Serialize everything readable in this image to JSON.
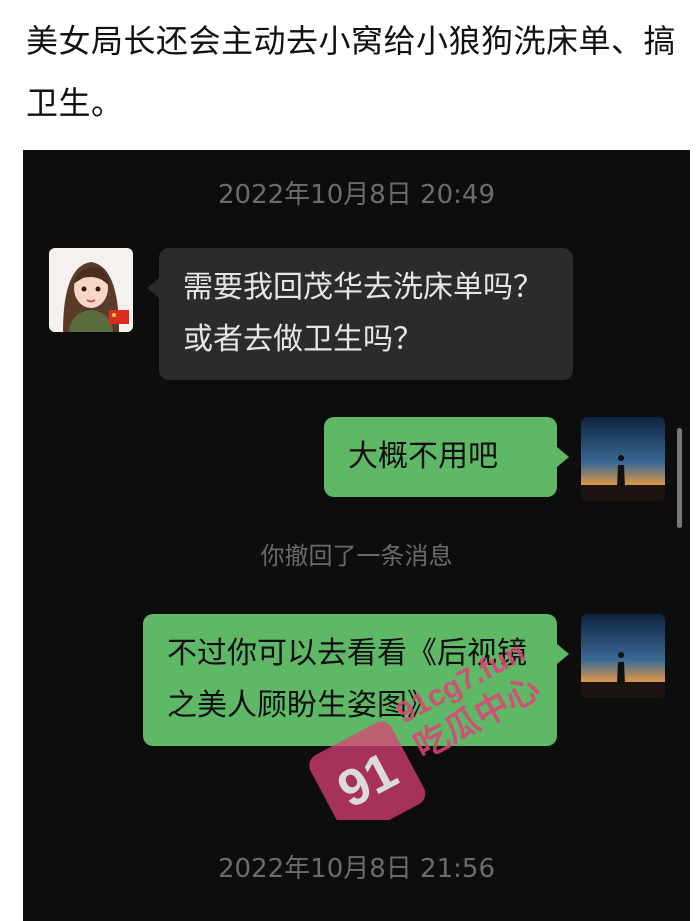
{
  "caption": "美女局长还会主动去小窝给小狼狗洗床单、搞卫生。",
  "chat": {
    "timestamp_1": "2022年10月8日 20:49",
    "message_1": "需要我回茂华去洗床单吗？或者去做卫生吗？",
    "message_2": "大概不用吧",
    "recall_notice": "你撤回了一条消息",
    "message_3": "不过你可以去看看《后视镜之美人顾盼生姿图》",
    "timestamp_2": "2022年10月8日 21:56"
  },
  "watermark": {
    "number": "91",
    "site": "91cg7.fun",
    "name": "吃瓜中心"
  },
  "colors": {
    "chat_bg": "#0d0d0d",
    "received_bubble": "#2b2b2b",
    "sent_bubble": "#5fb866",
    "watermark": "#e0417a"
  },
  "icons": {
    "left_avatar": "cartoon-woman-avatar",
    "right_avatar": "sunset-silhouette-avatar"
  }
}
